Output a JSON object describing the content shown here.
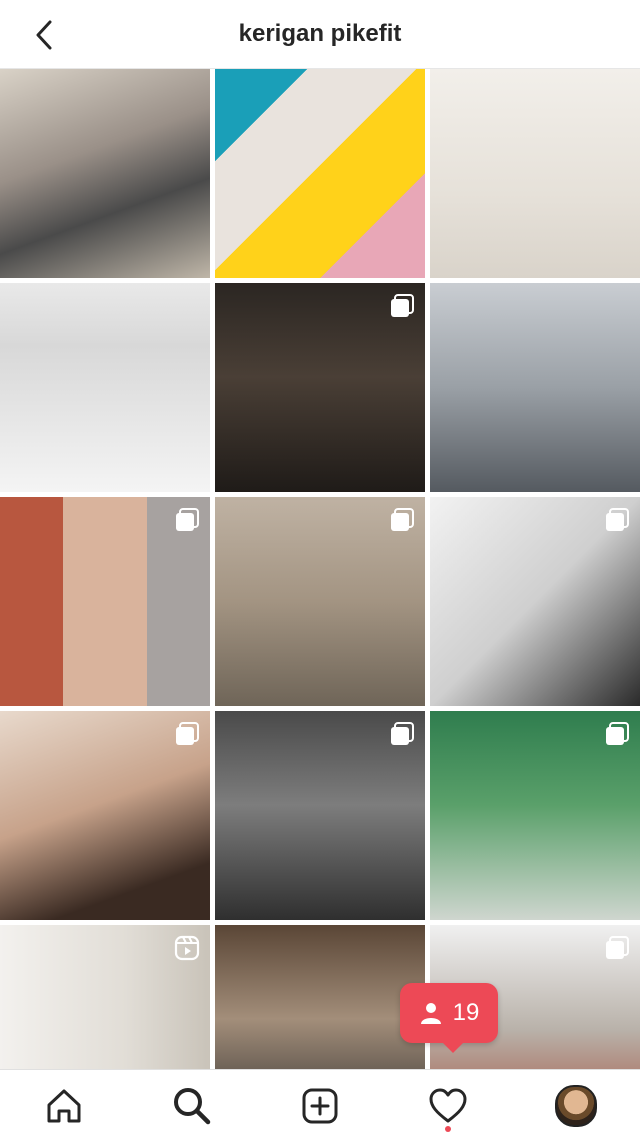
{
  "header": {
    "title": "kerigan pikefit"
  },
  "grid": {
    "tiles": [
      {
        "indicator": "none"
      },
      {
        "indicator": "none"
      },
      {
        "indicator": "none"
      },
      {
        "indicator": "none"
      },
      {
        "indicator": "multi"
      },
      {
        "indicator": "none"
      },
      {
        "indicator": "multi"
      },
      {
        "indicator": "multi"
      },
      {
        "indicator": "multi"
      },
      {
        "indicator": "multi"
      },
      {
        "indicator": "multi"
      },
      {
        "indicator": "multi"
      },
      {
        "indicator": "reels"
      },
      {
        "indicator": "none"
      },
      {
        "indicator": "multi"
      }
    ]
  },
  "notification": {
    "count": "19"
  },
  "tabbar": {
    "items": [
      "home-icon",
      "search-icon",
      "add-icon",
      "heart-icon",
      "profile-avatar"
    ]
  }
}
